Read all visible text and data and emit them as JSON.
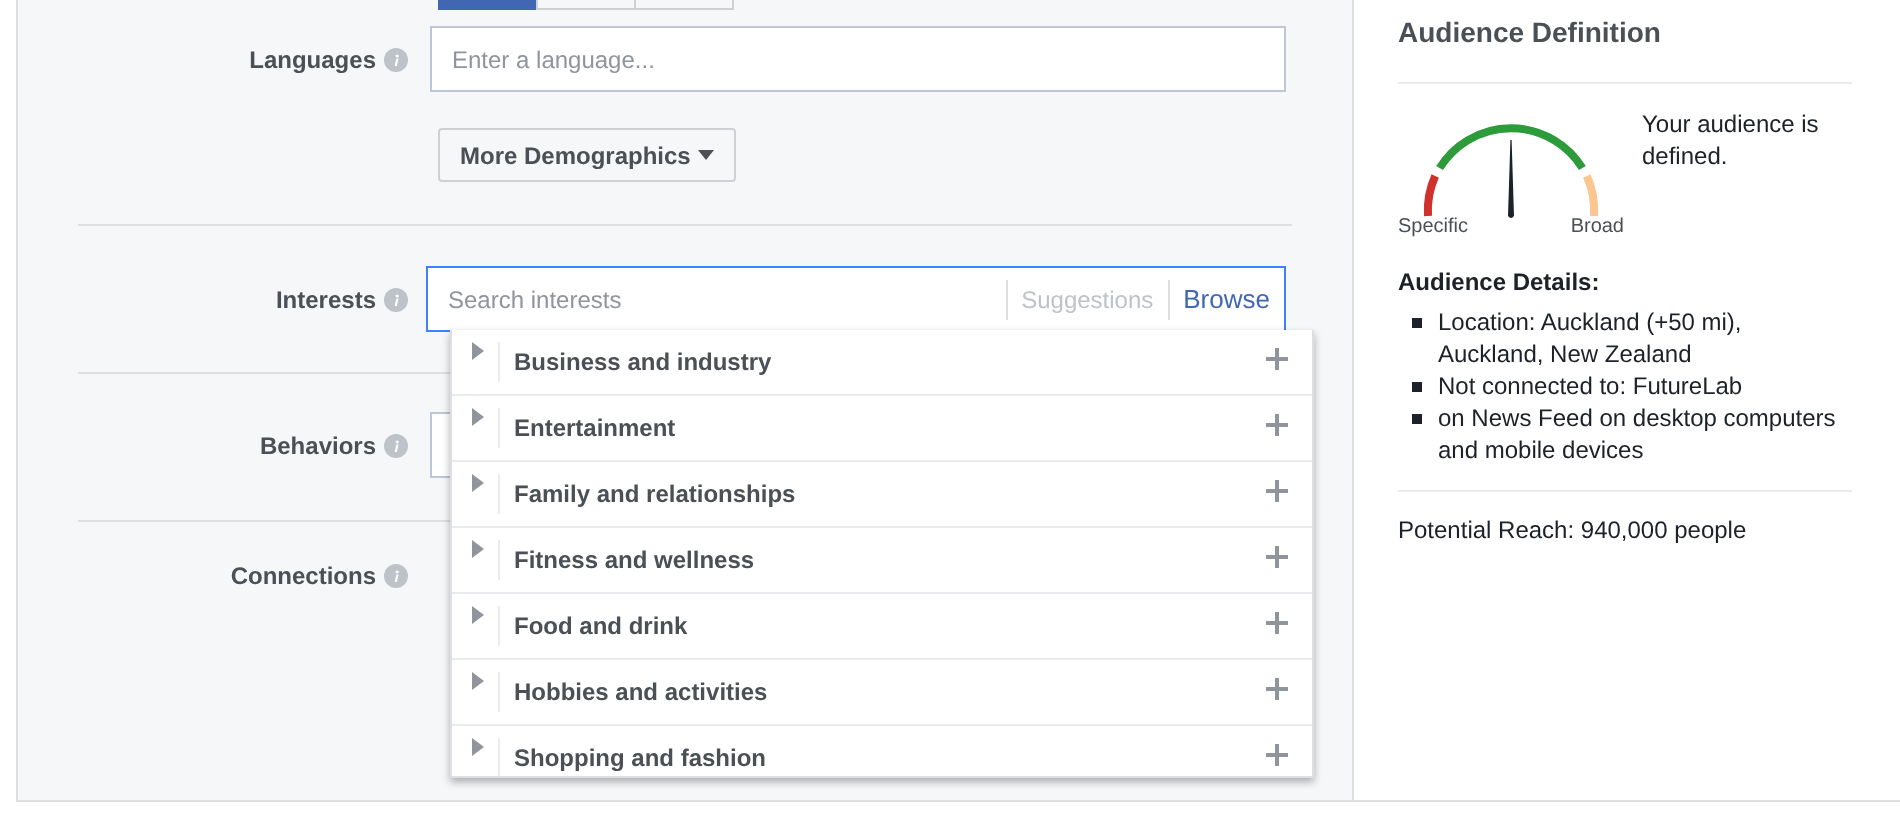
{
  "gender_buttons": [
    {
      "selected": true
    },
    {
      "selected": false
    },
    {
      "selected": false
    }
  ],
  "languages": {
    "label": "Languages",
    "placeholder": "Enter a language..."
  },
  "more_demographics": {
    "label": "More Demographics"
  },
  "interests": {
    "label": "Interests",
    "placeholder": "Search interests",
    "tabs": [
      {
        "label": "Suggestions",
        "selected": false
      },
      {
        "label": "Browse",
        "selected": true
      }
    ],
    "categories": [
      {
        "label": "Business and industry",
        "expanded": false
      },
      {
        "label": "Entertainment",
        "expanded": false
      },
      {
        "label": "Family and relationships",
        "expanded": false
      },
      {
        "label": "Fitness and wellness",
        "expanded": false
      },
      {
        "label": "Food and drink",
        "expanded": false
      },
      {
        "label": "Hobbies and activities",
        "expanded": false
      },
      {
        "label": "Shopping and fashion",
        "expanded": false
      }
    ]
  },
  "behaviors": {
    "label": "Behaviors"
  },
  "connections": {
    "label": "Connections"
  },
  "audience": {
    "title": "Audience Definition",
    "gauge": {
      "level": 0.5,
      "min_label": "Specific",
      "max_label": "Broad"
    },
    "status": "Your audience is defined.",
    "details_title": "Audience Details:",
    "details": [
      "Location: Auckland (+50 mi), Auckland, New Zealand",
      "Not connected to: FutureLab",
      "on News Feed on desktop computers and mobile devices"
    ],
    "potential_reach": "Potential Reach: 940,000 people"
  }
}
